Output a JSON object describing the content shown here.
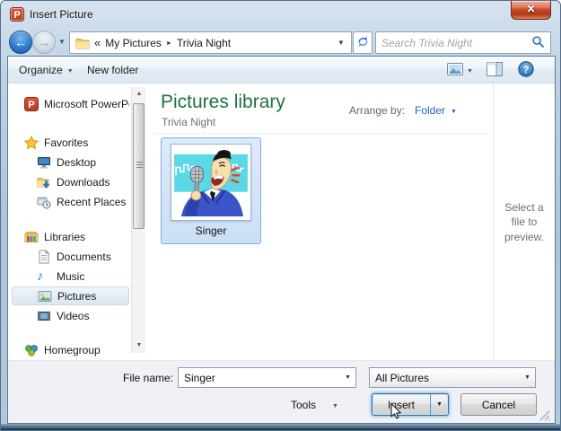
{
  "window": {
    "title": "Insert Picture"
  },
  "icons": {
    "close": "✕",
    "back_arrow": "←",
    "forward_arrow": "→",
    "dropdown": "▼",
    "breadcrumb_separator": "►",
    "help": "?",
    "music_note": "♪"
  },
  "nav": {
    "breadcrumb": {
      "overflow": "«",
      "crumbs": [
        "My Pictures",
        "Trivia Night"
      ]
    },
    "search_placeholder": "Search Trivia Night"
  },
  "toolbar": {
    "organize_label": "Organize",
    "new_folder_label": "New folder"
  },
  "sidebar": {
    "items": [
      {
        "label": "Microsoft PowerPoint",
        "icon": "powerpoint-icon",
        "level": 0,
        "selected": false
      },
      {
        "label": "Favorites",
        "icon": "star-icon",
        "level": 0,
        "selected": false
      },
      {
        "label": "Desktop",
        "icon": "desktop-icon",
        "level": 1,
        "selected": false
      },
      {
        "label": "Downloads",
        "icon": "downloads-icon",
        "level": 1,
        "selected": false
      },
      {
        "label": "Recent Places",
        "icon": "recent-places-icon",
        "level": 1,
        "selected": false
      },
      {
        "label": "Libraries",
        "icon": "libraries-icon",
        "level": 0,
        "selected": false
      },
      {
        "label": "Documents",
        "icon": "documents-icon",
        "level": 1,
        "selected": false
      },
      {
        "label": "Music",
        "icon": "music-icon",
        "level": 1,
        "selected": false
      },
      {
        "label": "Pictures",
        "icon": "pictures-icon",
        "level": 1,
        "selected": true
      },
      {
        "label": "Videos",
        "icon": "videos-icon",
        "level": 1,
        "selected": false
      },
      {
        "label": "Homegroup",
        "icon": "homegroup-icon",
        "level": 0,
        "selected": false
      }
    ]
  },
  "main": {
    "library_title": "Pictures library",
    "library_location": "Trivia Night",
    "arrange_by_label": "Arrange by:",
    "arrange_by_value": "Folder",
    "files": [
      {
        "name": "Singer",
        "selected": true
      }
    ]
  },
  "preview": {
    "message": "Select a file to preview."
  },
  "footer": {
    "file_name_label": "File name:",
    "file_name_value": "Singer",
    "file_type_value": "All Pictures",
    "tools_label": "Tools",
    "insert_label": "Insert",
    "cancel_label": "Cancel"
  },
  "colors": {
    "glass_frame": "#b2c8dc",
    "library_title_green": "#1e7145",
    "link_blue": "#2364b8",
    "selection_fill": "#ddebfb",
    "selection_border": "#84acdd",
    "close_button_red": "#c44425"
  }
}
